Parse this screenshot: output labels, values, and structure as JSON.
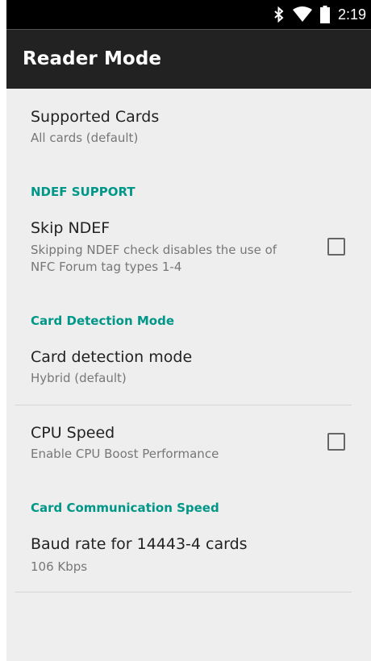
{
  "status_bar": {
    "time": "2:19",
    "icons": [
      "bluetooth-icon",
      "wifi-icon",
      "battery-icon"
    ]
  },
  "app_bar": {
    "title": "Reader Mode"
  },
  "preferences": {
    "supported_cards": {
      "title": "Supported Cards",
      "summary": "All cards (default)"
    },
    "ndef_category": "NDEF SUPPORT",
    "skip_ndef": {
      "title": "Skip NDEF",
      "summary_line1": "Skipping NDEF check disables the use of",
      "summary_line2": "NFC Forum tag types 1-4",
      "checked": false
    },
    "detection_category": "Card Detection Mode",
    "card_detection_mode": {
      "title": "Card detection mode",
      "summary": "Hybrid (default)"
    },
    "cpu_speed": {
      "title": "CPU Speed",
      "summary": "Enable CPU Boost Performance",
      "checked": false
    },
    "communication_category": "Card Communication Speed",
    "baud_rate": {
      "title": "Baud rate for 14443-4 cards",
      "summary": "106 Kbps"
    }
  },
  "colors": {
    "accent": "#009688",
    "app_bar": "#222222",
    "background": "#eeeeee"
  }
}
